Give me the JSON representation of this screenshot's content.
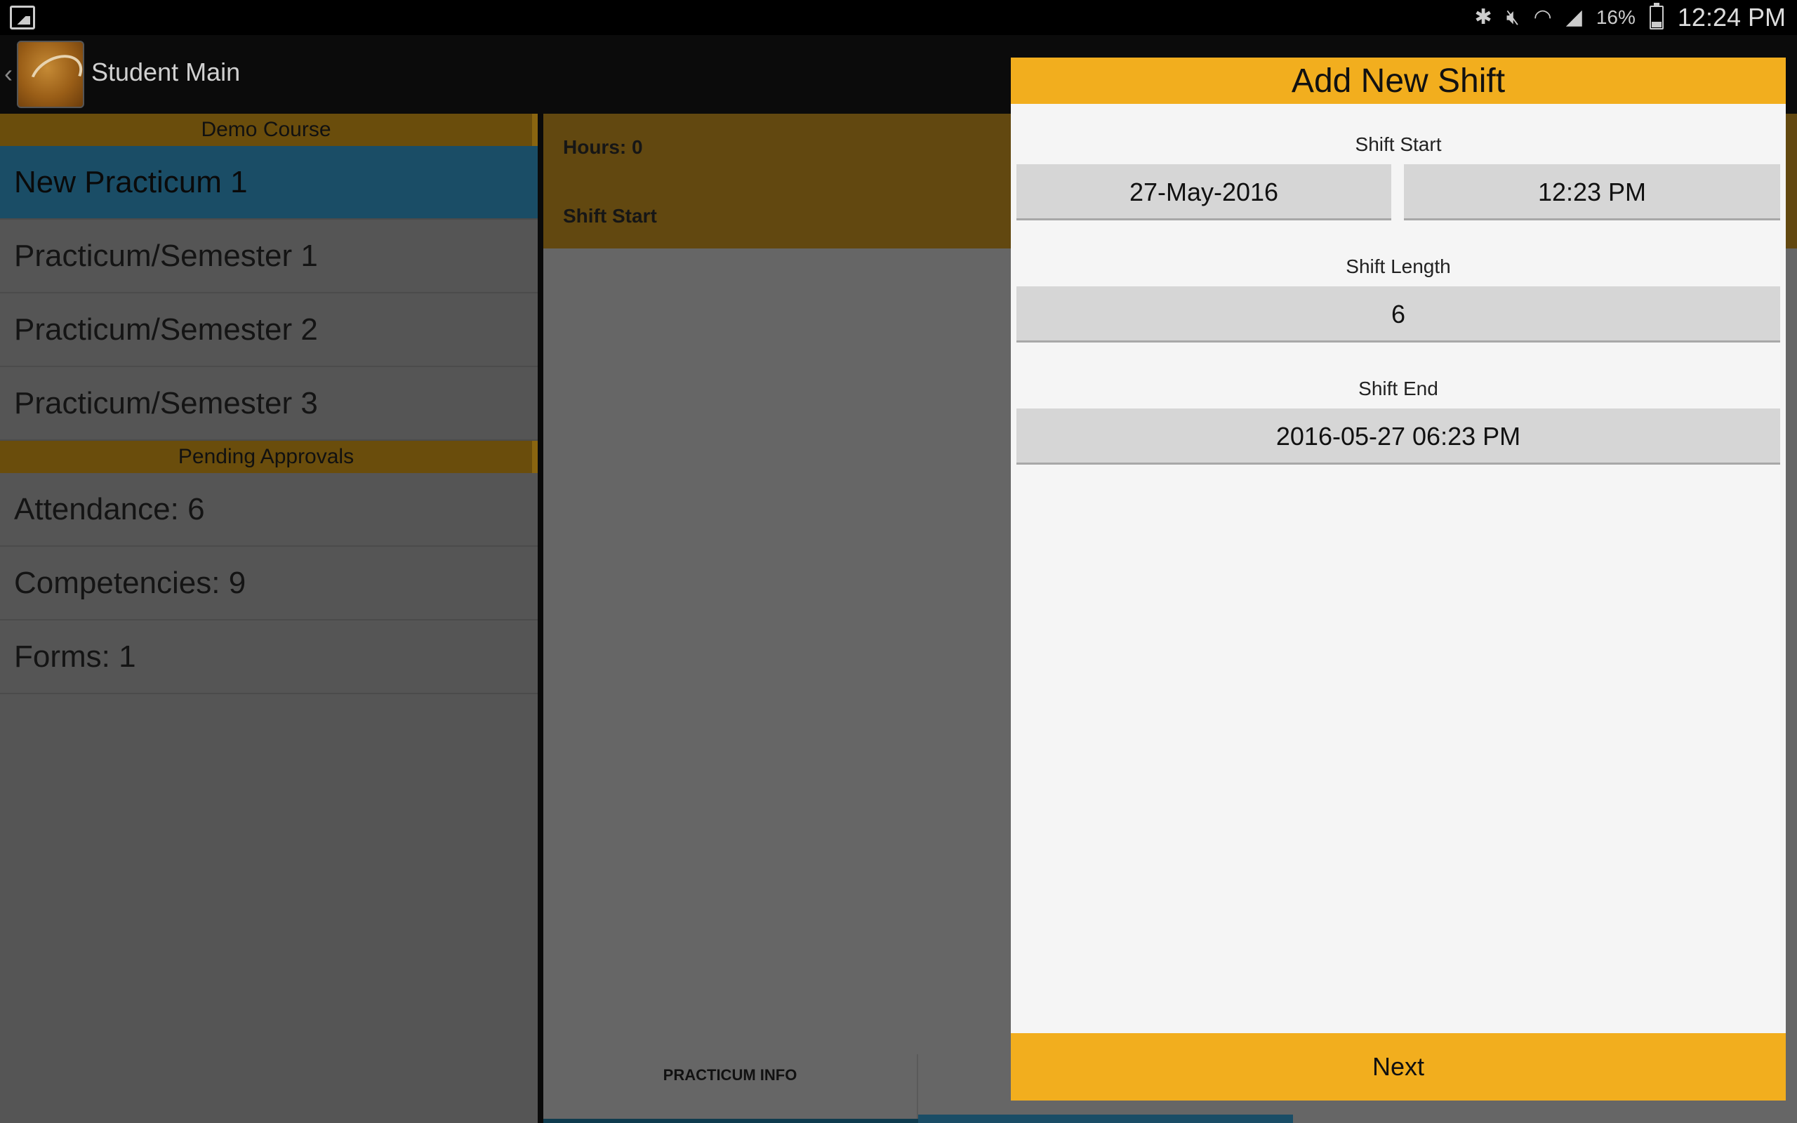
{
  "status_bar": {
    "battery_percent": "16%",
    "time": "12:24 PM",
    "icons": [
      "bluetooth-icon",
      "mute-icon",
      "wifi-icon",
      "signal-icon",
      "battery-icon"
    ]
  },
  "action_bar": {
    "title": "Student Main"
  },
  "sidebar": {
    "course_header": "Demo Course",
    "practicums": [
      {
        "label": "New Practicum 1",
        "selected": true
      },
      {
        "label": "Practicum/Semester 1"
      },
      {
        "label": "Practicum/Semester 2"
      },
      {
        "label": "Practicum/Semester 3"
      }
    ],
    "pending_header": "Pending Approvals",
    "pending": [
      {
        "label": "Attendance: 6"
      },
      {
        "label": "Competencies: 9"
      },
      {
        "label": "Forms: 1"
      }
    ]
  },
  "content": {
    "hours_label": "Hours:  0",
    "shift_start_label": "Shift Start",
    "tabs": [
      {
        "label": "PRACTICUM INFO"
      }
    ]
  },
  "dialog": {
    "title": "Add New Shift",
    "shift_start_label": "Shift Start",
    "shift_start_date": "27-May-2016",
    "shift_start_time": "12:23 PM",
    "shift_length_label": "Shift Length",
    "shift_length_value": "6",
    "shift_end_label": "Shift End",
    "shift_end_value": "2016-05-27 06:23 PM",
    "next_label": "Next"
  },
  "colors": {
    "accent": "#f2ae1e",
    "selected": "#1a4d66"
  }
}
